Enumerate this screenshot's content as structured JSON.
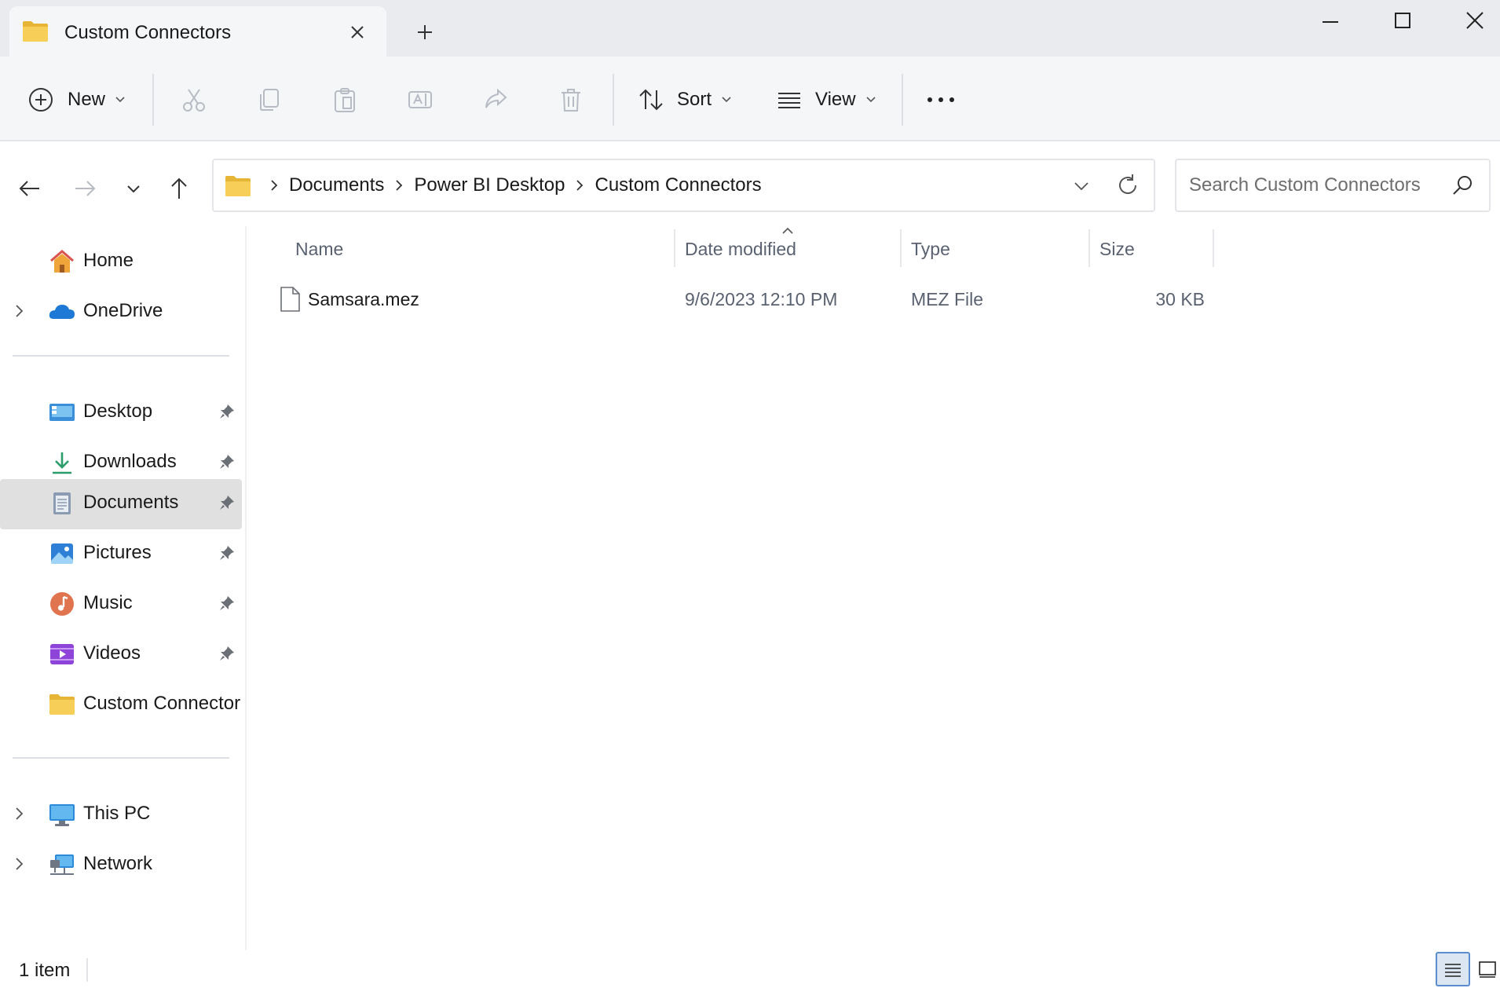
{
  "window": {
    "tab_title": "Custom Connectors"
  },
  "toolbar": {
    "new_label": "New",
    "sort_label": "Sort",
    "view_label": "View"
  },
  "address": {
    "crumbs": [
      "Documents",
      "Power BI Desktop",
      "Custom Connectors"
    ]
  },
  "search": {
    "placeholder": "Search Custom Connectors"
  },
  "sidebar": {
    "items": [
      {
        "label": "Home",
        "icon": "home-icon"
      },
      {
        "label": "OneDrive",
        "icon": "onedrive-icon"
      },
      {
        "label": "Desktop",
        "icon": "desktop-icon"
      },
      {
        "label": "Downloads",
        "icon": "downloads-icon"
      },
      {
        "label": "Documents",
        "icon": "documents-icon",
        "selected": true
      },
      {
        "label": "Pictures",
        "icon": "pictures-icon"
      },
      {
        "label": "Music",
        "icon": "music-icon"
      },
      {
        "label": "Videos",
        "icon": "videos-icon"
      },
      {
        "label": "Custom Connector",
        "icon": "folder-icon"
      },
      {
        "label": "This PC",
        "icon": "this-pc-icon"
      },
      {
        "label": "Network",
        "icon": "network-icon"
      }
    ]
  },
  "columns": {
    "name": "Name",
    "date": "Date modified",
    "type": "Type",
    "size": "Size"
  },
  "files": [
    {
      "name": "Samsara.mez",
      "date": "9/6/2023 12:10 PM",
      "type": "MEZ File",
      "size": "30 KB"
    }
  ],
  "status": {
    "count": "1 item"
  },
  "colors": {
    "accent": "#0067c0",
    "folder": "#f4c54a",
    "selected_bg": "#e0e0e0"
  }
}
